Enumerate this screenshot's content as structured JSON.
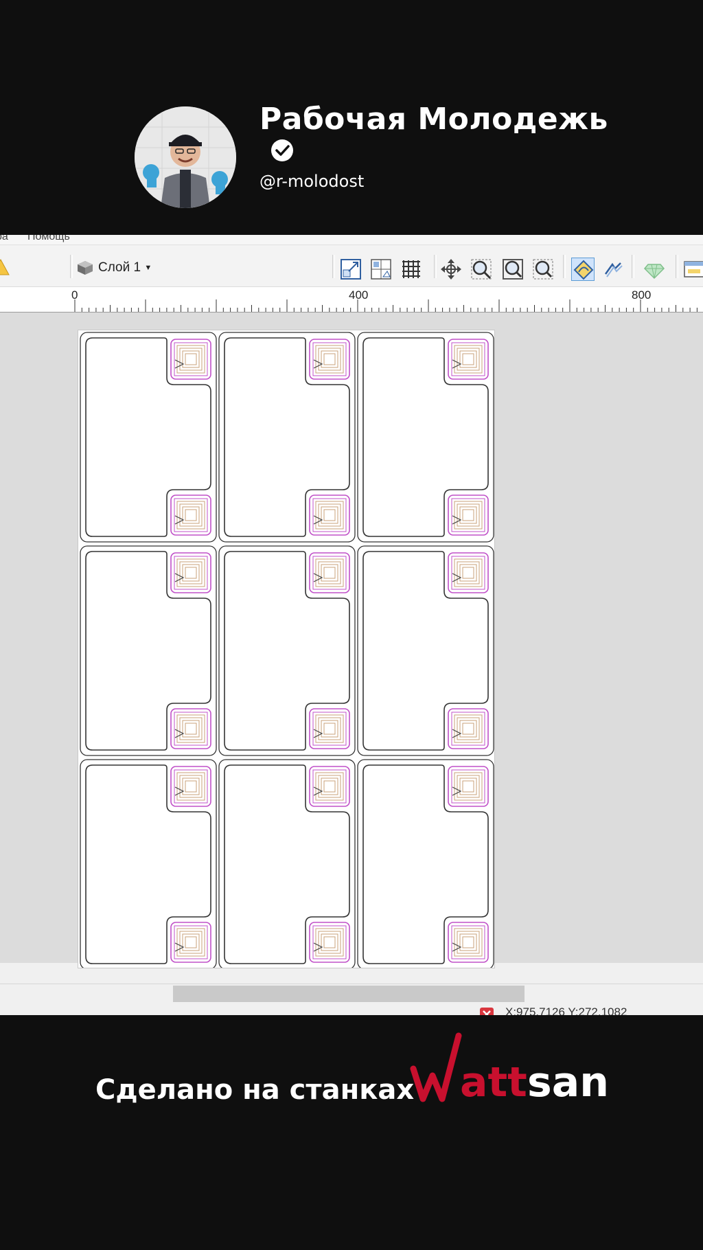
{
  "channel": {
    "name": "Рабочая Молодежь",
    "handle": "@r-molodost"
  },
  "app": {
    "menu": {
      "item_partial": "ра",
      "help": "Помощь"
    },
    "toolbar": {
      "layer_label": "Слой 1"
    },
    "ruler": {
      "ticks": [
        "0",
        "400",
        "800"
      ]
    },
    "status_bar": {
      "coords": "X:975.7126 Y:272.1082"
    },
    "sheet": {
      "rows": 3,
      "cols": 3
    }
  },
  "footer": {
    "text": "Сделано на станках",
    "brand": {
      "part1": "Watt",
      "part2": "san",
      "color_red": "#c8102e",
      "color_white": "#ffffff"
    }
  },
  "colors": {
    "background": "#0f0f0f",
    "coil": "#c050c8",
    "outline": "#333333"
  }
}
